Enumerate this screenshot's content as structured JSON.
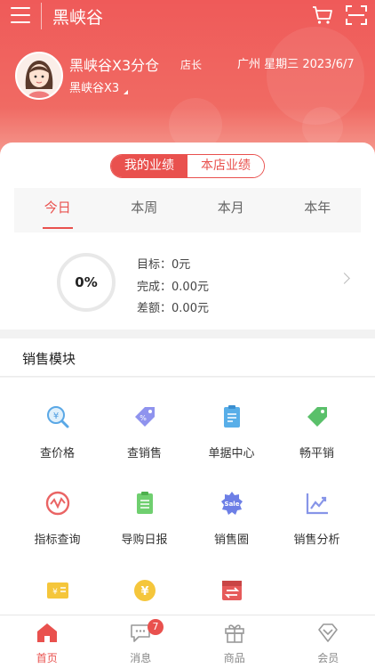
{
  "app": {
    "title": "黑峡谷"
  },
  "profile": {
    "store_name": "黑峡谷X3分仓",
    "role": "店长",
    "city": "广州",
    "weekday": "星期三",
    "date": "2023/6/7",
    "sub_store": "黑峡谷X3"
  },
  "performance": {
    "toggle": [
      "我的业绩",
      "本店业绩"
    ],
    "active_toggle": "我的业绩",
    "tabs": [
      "今日",
      "本周",
      "本月",
      "本年"
    ],
    "active_tab": "今日",
    "percent": "0%",
    "target_label": "目标：",
    "target_value": "0元",
    "done_label": "完成：",
    "done_value": "0.00元",
    "diff_label": "差额：",
    "diff_value": "0.00元"
  },
  "sales_module": {
    "title": "销售模块",
    "items": [
      {
        "label": "查价格",
        "icon": "price-check-icon"
      },
      {
        "label": "查销售",
        "icon": "sales-query-icon"
      },
      {
        "label": "单据中心",
        "icon": "document-center-icon"
      },
      {
        "label": "畅平销",
        "icon": "tag-icon"
      },
      {
        "label": "指标查询",
        "icon": "indicator-icon"
      },
      {
        "label": "导购日报",
        "icon": "daily-report-icon"
      },
      {
        "label": "销售圈",
        "icon": "sale-badge-icon"
      },
      {
        "label": "销售分析",
        "icon": "trend-chart-icon"
      }
    ],
    "partial_row_icons": [
      "coupon-icon",
      "yen-coin-icon",
      "transfer-icon"
    ]
  },
  "tabbar": {
    "items": [
      {
        "label": "首页",
        "icon": "home-icon"
      },
      {
        "label": "消息",
        "icon": "message-icon"
      },
      {
        "label": "商品",
        "icon": "gift-icon"
      },
      {
        "label": "会员",
        "icon": "member-diamond-icon"
      }
    ],
    "active": "首页",
    "message_badge": "7"
  },
  "colors": {
    "accent": "#e9514e",
    "header_top": "#ef5a59"
  }
}
